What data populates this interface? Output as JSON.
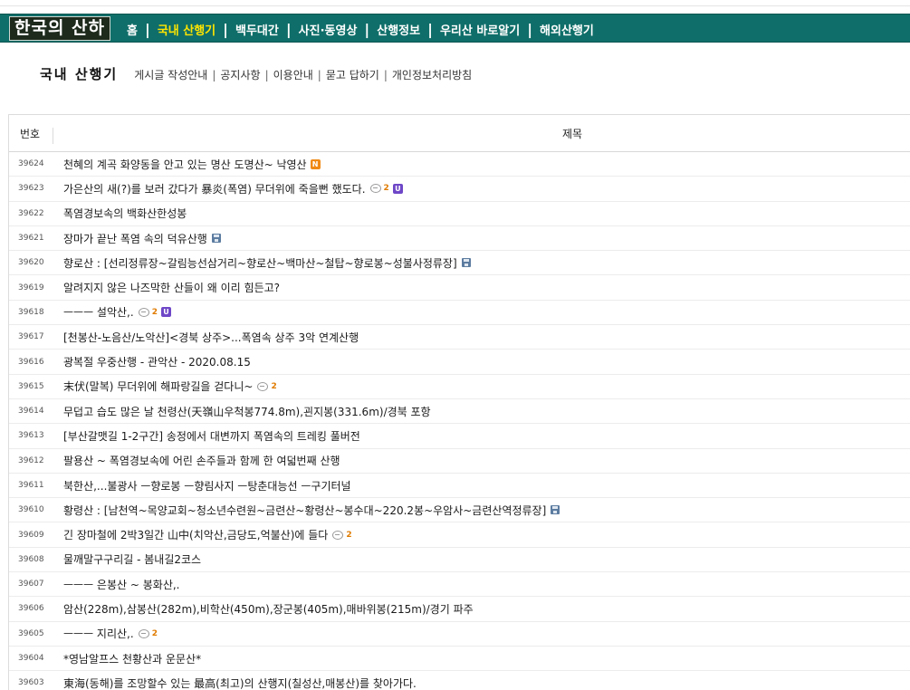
{
  "site": {
    "logo_text": "한국의 산하"
  },
  "nav": {
    "items": [
      {
        "label": "홈",
        "active": false
      },
      {
        "label": "국내 산행기",
        "active": true
      },
      {
        "label": "백두대간",
        "active": false
      },
      {
        "label": "사진·동영상",
        "active": false
      },
      {
        "label": "산행정보",
        "active": false
      },
      {
        "label": "우리산 바로알기",
        "active": false
      },
      {
        "label": "해외산행기",
        "active": false
      }
    ],
    "separator": "|"
  },
  "subheader": {
    "title": "국내 산행기",
    "links": [
      "게시글 작성안내",
      "공지사항",
      "이용안내",
      "묻고 답하기",
      "개인정보처리방침"
    ],
    "separator": "|"
  },
  "board": {
    "columns": {
      "number": "번호",
      "subject": "제목"
    },
    "rows": [
      {
        "num": "39624",
        "title": "천혜의 계곡 화양동을 안고 있는 명산 도명산~ 낙영산",
        "comments": null,
        "badge": "N",
        "file": false
      },
      {
        "num": "39623",
        "title": "가은산의 새(?)를 보러 갔다가 暴炎(폭염) 무더위에 죽을뻔 했도다.",
        "comments": "2",
        "badge": "U",
        "file": false
      },
      {
        "num": "39622",
        "title": "폭염경보속의 백화산한성봉",
        "comments": null,
        "badge": null,
        "file": false
      },
      {
        "num": "39621",
        "title": "장마가 끝난 폭염 속의 덕유산행",
        "comments": null,
        "badge": null,
        "file": true
      },
      {
        "num": "39620",
        "title": "향로산 : [선리정류장~갈림능선삼거리~향로산~백마산~철탑~향로봉~성불사정류장]",
        "comments": null,
        "badge": null,
        "file": true
      },
      {
        "num": "39619",
        "title": "알려지지 않은 나즈막한 산들이 왜 이리 힘든고?",
        "comments": null,
        "badge": null,
        "file": false
      },
      {
        "num": "39618",
        "title": "ㅡㅡㅡ 설악산,.",
        "comments": "2",
        "badge": "U",
        "file": false
      },
      {
        "num": "39617",
        "title": "[천봉산-노음산/노악산]<경북 상주>...폭염속 상주 3악 연계산행",
        "comments": null,
        "badge": null,
        "file": false
      },
      {
        "num": "39616",
        "title": "광복절 우중산행 - 관악산 - 2020.08.15",
        "comments": null,
        "badge": null,
        "file": false
      },
      {
        "num": "39615",
        "title": "末伏(말복) 무더위에 해파랑길을 걷다니~",
        "comments": "2",
        "badge": null,
        "file": false
      },
      {
        "num": "39614",
        "title": "무덥고 습도 많은 날 천령산(天嶺山우척봉774.8m),괸지봉(331.6m)/경북 포항",
        "comments": null,
        "badge": null,
        "file": false
      },
      {
        "num": "39613",
        "title": "[부산갈맷길 1-2구간] 송정에서 대변까지 폭염속의 트레킹 풀버전",
        "comments": null,
        "badge": null,
        "file": false
      },
      {
        "num": "39612",
        "title": "팔용산 ~ 폭염경보속에 어린 손주들과 함께 한 여덟번째 산행",
        "comments": null,
        "badge": null,
        "file": false
      },
      {
        "num": "39611",
        "title": "북한산,...불광사 ㅡ향로봉 ㅡ향림사지 ㅡ탕춘대능선 ㅡ구기터널",
        "comments": null,
        "badge": null,
        "file": false
      },
      {
        "num": "39610",
        "title": "황령산 : [남천역~목양교회~청소년수련원~금련산~황령산~봉수대~220.2봉~우암사~금련산역정류장]",
        "comments": null,
        "badge": null,
        "file": true
      },
      {
        "num": "39609",
        "title": "긴 장마철에 2박3일간 山中(치악산,금당도,억불산)에 들다",
        "comments": "2",
        "badge": null,
        "file": false
      },
      {
        "num": "39608",
        "title": "물깨말구구리길 - 봄내길2코스",
        "comments": null,
        "badge": null,
        "file": false
      },
      {
        "num": "39607",
        "title": "ㅡㅡㅡ 은봉산 ~ 봉화산,.",
        "comments": null,
        "badge": null,
        "file": false
      },
      {
        "num": "39606",
        "title": "암산(228m),삼봉산(282m),비학산(450m),장군봉(405m),매바위봉(215m)/경기 파주",
        "comments": null,
        "badge": null,
        "file": false
      },
      {
        "num": "39605",
        "title": "ㅡㅡㅡ 지리산,.",
        "comments": "2",
        "badge": null,
        "file": false
      },
      {
        "num": "39604",
        "title": "*영남알프스 천황산과 운문산*",
        "comments": null,
        "badge": null,
        "file": false
      },
      {
        "num": "39603",
        "title": "東海(동해)를 조망할수 있는 最高(최고)의 산행지(칠성산,매봉산)를 찾아가다.",
        "comments": null,
        "badge": null,
        "file": false
      }
    ]
  }
}
